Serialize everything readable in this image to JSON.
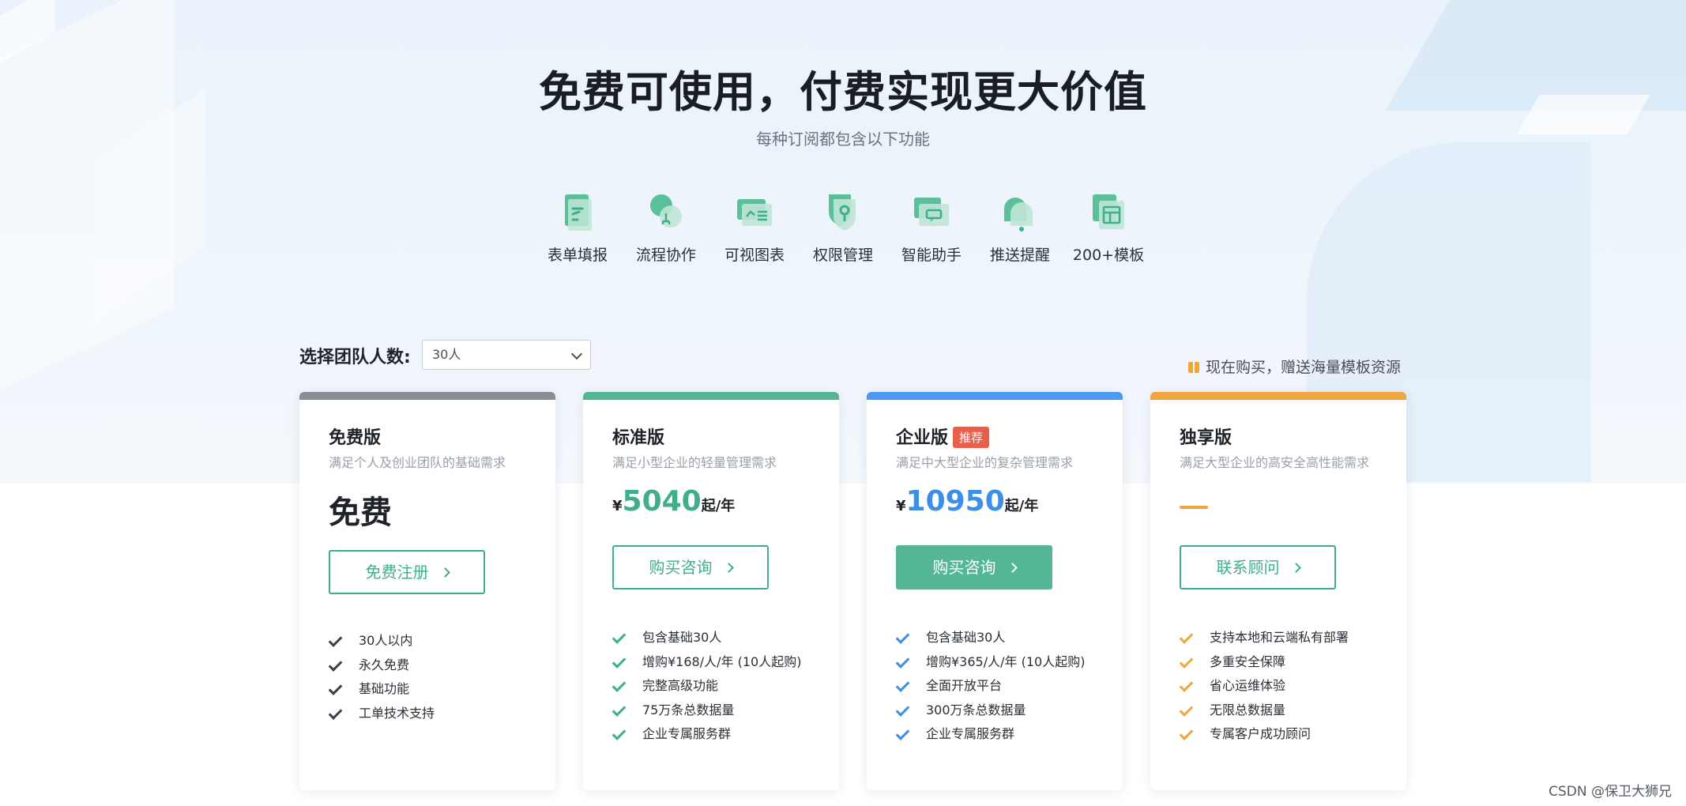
{
  "header": {
    "title": "免费可使用，付费实现更大价值",
    "subtitle": "每种订阅都包含以下功能"
  },
  "features": [
    {
      "label": "表单填报",
      "icon": "form-icon"
    },
    {
      "label": "流程协作",
      "icon": "workflow-icon"
    },
    {
      "label": "可视图表",
      "icon": "chart-icon"
    },
    {
      "label": "权限管理",
      "icon": "permission-icon"
    },
    {
      "label": "智能助手",
      "icon": "assistant-icon"
    },
    {
      "label": "推送提醒",
      "icon": "bell-icon"
    },
    {
      "label": "200+模板",
      "icon": "template-icon"
    }
  ],
  "team": {
    "label": "选择团队人数:",
    "selected": "30人"
  },
  "promo": "现在购买，赠送海量模板资源",
  "plans": [
    {
      "name": "免费版",
      "desc": "满足个人及创业团队的基础需求",
      "price": "免费",
      "button": "免费注册",
      "accent": "#8a8d94",
      "check_color": "#3c4048",
      "items": [
        "30人以内",
        "永久免费",
        "基础功能",
        "工单技术支持"
      ]
    },
    {
      "name": "标准版",
      "desc": "满足小型企业的轻量管理需求",
      "currency": "¥",
      "price": "5040",
      "unit": "起/年",
      "button": "购买咨询",
      "accent": "#52b792",
      "price_color": "#3fae8c",
      "check_color": "#3fae8c",
      "items": [
        "包含基础30人",
        "增购¥168/人/年 (10人起购)",
        "完整高级功能",
        "75万条总数据量",
        "企业专属服务群"
      ]
    },
    {
      "name": "企业版",
      "badge": "推荐",
      "desc": "满足中大型企业的复杂管理需求",
      "currency": "¥",
      "price": "10950",
      "unit": "起/年",
      "button": "购买咨询",
      "accent": "#4a9af0",
      "price_color": "#3b8fe6",
      "check_color": "#3b8fe6",
      "items": [
        "包含基础30人",
        "增购¥365/人/年 (10人起购)",
        "全面开放平台",
        "300万条总数据量",
        "企业专属服务群"
      ]
    },
    {
      "name": "独享版",
      "desc": "满足大型企业的高安全高性能需求",
      "button": "联系顾问",
      "accent": "#f0a63d",
      "check_color": "#f0a63d",
      "items": [
        "支持本地和云端私有部署",
        "多重安全保障",
        "省心运维体验",
        "无限总数据量",
        "专属客户成功顾问"
      ]
    }
  ],
  "watermark": "CSDN @保卫大狮兄"
}
